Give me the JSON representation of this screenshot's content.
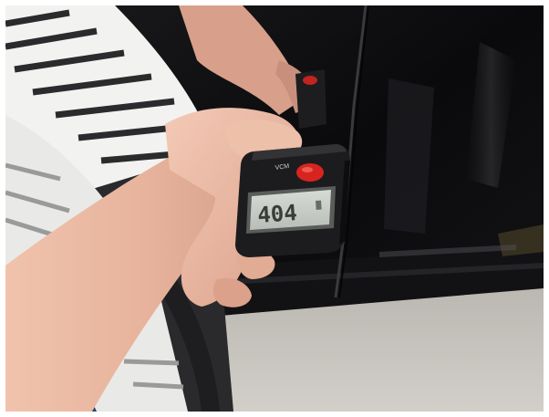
{
  "photo": {
    "subject": "paint-thickness-gauge-on-car-door",
    "colors": {
      "car_paint": "#0c0c0e",
      "skin": "#e7b8a2",
      "sleeve": "#27324a",
      "gauge_body": "#1c1c1c",
      "gauge_button": "#d8241f",
      "lcd_screen": "#c9cdc8",
      "floor": "#c9c6c0",
      "tire": "#2a2a2a"
    }
  },
  "gauge": {
    "reading": "404",
    "brand_text": "VCM"
  }
}
